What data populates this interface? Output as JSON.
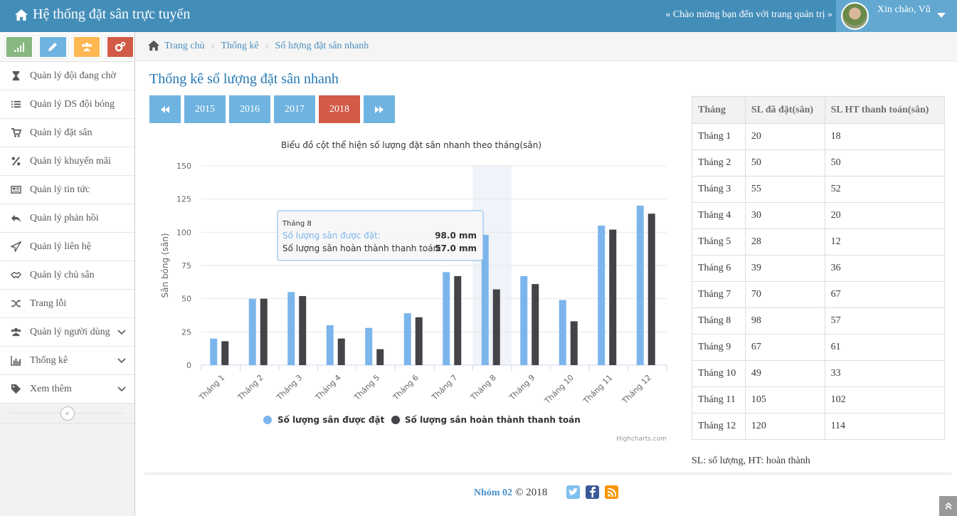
{
  "navbar": {
    "brand": "Hệ thống đặt sân trực tuyến",
    "welcome": "« Chào mừng bạn đến với trang quản trị »",
    "greeting": "Xin chào, Vũ"
  },
  "shortcuts": [
    {
      "name": "stats",
      "color": "#87b87f",
      "icon": "signal-icon"
    },
    {
      "name": "edit",
      "color": "#6fb3e0",
      "icon": "pencil-icon"
    },
    {
      "name": "users",
      "color": "#ffb752",
      "icon": "users-icon"
    },
    {
      "name": "settings",
      "color": "#d15b47",
      "icon": "cogs-icon"
    }
  ],
  "sidebar": {
    "items": [
      {
        "label": "Quản lý đội đang chờ",
        "icon": "hourglass-icon"
      },
      {
        "label": "Quản lý DS đội bóng",
        "icon": "list-icon"
      },
      {
        "label": "Quản lý đặt sân",
        "icon": "cart-icon"
      },
      {
        "label": "Quản lý khuyến mãi",
        "icon": "percent-icon"
      },
      {
        "label": "Quản lý tin tức",
        "icon": "newspaper-icon"
      },
      {
        "label": "Quản lý phản hồi",
        "icon": "reply-icon"
      },
      {
        "label": "Quản lý liên hệ",
        "icon": "paper-plane-icon"
      },
      {
        "label": "Quản lý chủ sân",
        "icon": "handshake-icon"
      },
      {
        "label": "Trang lỗi",
        "icon": "random-icon"
      },
      {
        "label": "Quản lý người dùng",
        "icon": "users-icon"
      },
      {
        "label": "Thống kê",
        "icon": "bar-chart-icon"
      },
      {
        "label": "Xem thêm",
        "icon": "tag-icon"
      }
    ]
  },
  "breadcrumb": {
    "home": "Trang chủ",
    "section": "Thống kê",
    "current": "Số lượng đặt sân nhanh"
  },
  "page": {
    "title": "Thống kê số lượng đặt sân nhanh",
    "years": [
      "2015",
      "2016",
      "2017",
      "2018"
    ],
    "active_year": "2018"
  },
  "chart_data": {
    "type": "bar",
    "title": "Biểu đồ cột thể hiện số lượng đặt sân nhanh theo tháng(sân)",
    "ylabel": "Sân bóng (sân)",
    "xlabel": "",
    "ylim": [
      0,
      150
    ],
    "yticks": [
      0,
      25,
      50,
      75,
      100,
      125,
      150
    ],
    "categories": [
      "Tháng 1",
      "Tháng 2",
      "Tháng 3",
      "Tháng 4",
      "Tháng 5",
      "Tháng 6",
      "Tháng 7",
      "Tháng 8",
      "Tháng 9",
      "Tháng 10",
      "Tháng 11",
      "Tháng 12"
    ],
    "series": [
      {
        "name": "Số lượng sân được đặt",
        "color": "#7cb5ec",
        "values": [
          20,
          50,
          55,
          30,
          28,
          39,
          70,
          98,
          67,
          49,
          105,
          120
        ]
      },
      {
        "name": "Số lượng sân hoàn thành thanh toán",
        "color": "#434348",
        "values": [
          18,
          50,
          52,
          20,
          12,
          36,
          67,
          57,
          61,
          33,
          102,
          114
        ]
      }
    ],
    "legend": "bottom-center",
    "grid": true,
    "credits": "Highcharts.com",
    "highlighted_category": "Tháng 8",
    "tooltip": {
      "header": "Tháng 8",
      "rows": [
        {
          "label": "Số lượng sân được đặt:",
          "value": "98.0 mm"
        },
        {
          "label": "Số lượng sân hoàn thành thanh toán:",
          "value": "57.0 mm"
        }
      ]
    }
  },
  "table": {
    "headers": [
      "Tháng",
      "SL đã đặt(sân)",
      "SL HT thanh toán(sân)"
    ],
    "rows": [
      [
        "Tháng 1",
        "20",
        "18"
      ],
      [
        "Tháng 2",
        "50",
        "50"
      ],
      [
        "Tháng 3",
        "55",
        "52"
      ],
      [
        "Tháng 4",
        "30",
        "20"
      ],
      [
        "Tháng 5",
        "28",
        "12"
      ],
      [
        "Tháng 6",
        "39",
        "36"
      ],
      [
        "Tháng 7",
        "70",
        "67"
      ],
      [
        "Tháng 8",
        "98",
        "57"
      ],
      [
        "Tháng 9",
        "67",
        "61"
      ],
      [
        "Tháng 10",
        "49",
        "33"
      ],
      [
        "Tháng 11",
        "105",
        "102"
      ],
      [
        "Tháng 12",
        "120",
        "114"
      ]
    ]
  },
  "note": "SL: số lượng, HT: hoàn thành",
  "footer": {
    "team": "Nhóm 02",
    "copyright": "© 2018"
  }
}
